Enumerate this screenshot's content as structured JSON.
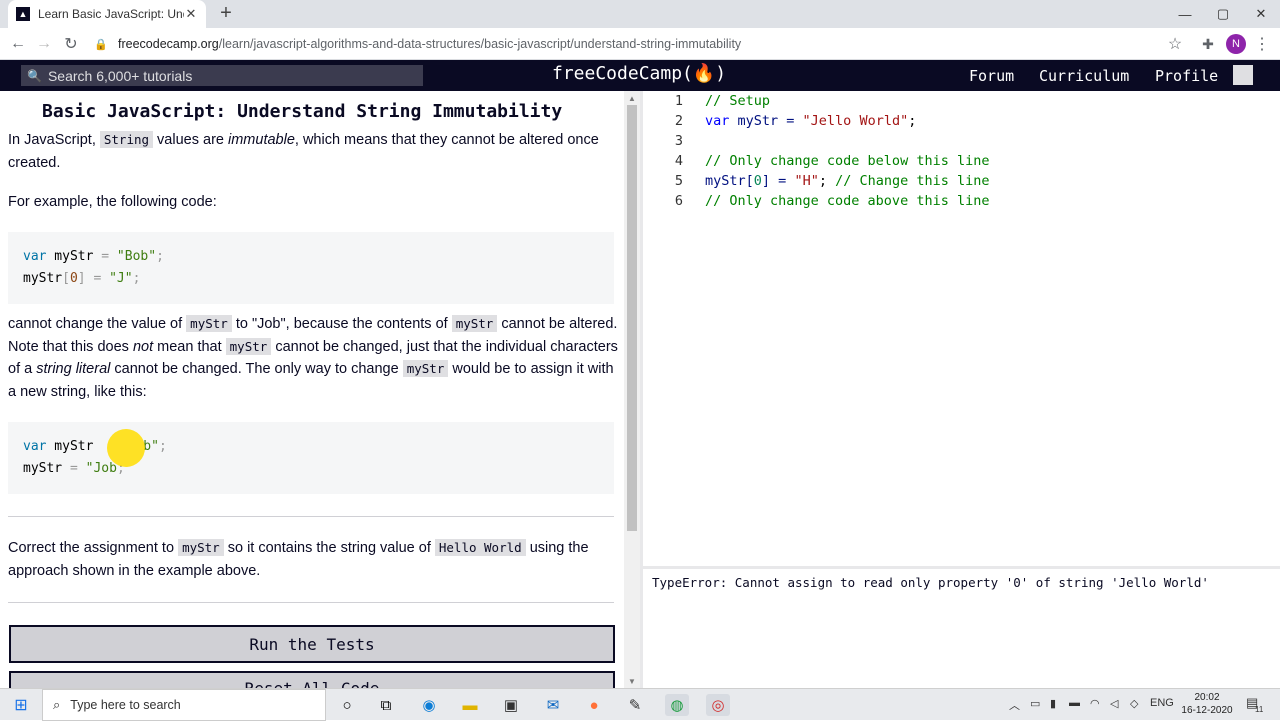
{
  "browser": {
    "tab_title": "Learn Basic JavaScript: Understan",
    "tab_favicon": "fcc-favicon",
    "url_host": "freecodecamp.org",
    "url_path": "/learn/javascript-algorithms-and-data-structures/basic-javascript/understand-string-immutability",
    "avatar_letter": "N"
  },
  "nav": {
    "search_placeholder": "Search 6,000+ tutorials",
    "logo": "freeCodeCamp(🔥)",
    "forum": "Forum",
    "curriculum": "Curriculum",
    "profile": "Profile"
  },
  "lesson": {
    "title": "Basic JavaScript: Understand String Immutability",
    "p1_a": "In JavaScript, ",
    "p1_code": "String",
    "p1_b": " values are ",
    "p1_em": "immutable",
    "p1_c": ", which means that they cannot be altered once created.",
    "p2": "For example, the following code:",
    "code1": {
      "l1_kw": "var",
      "l1_id": " myStr ",
      "l1_eq": "=",
      "l1_str": " \"Bob\"",
      "l1_end": ";",
      "l2_id": "myStr",
      "l2_b1": "[",
      "l2_num": "0",
      "l2_b2": "]",
      "l2_eq": " = ",
      "l2_str": "\"J\"",
      "l2_end": ";"
    },
    "p3_a": "cannot change the value of ",
    "p3_code1": "myStr",
    "p3_b": " to \"Job\", because the contents of ",
    "p3_code2": "myStr",
    "p3_c": " cannot be altered. Note that this does ",
    "p3_em1": "not",
    "p3_d": " mean that ",
    "p3_code3": "myStr",
    "p3_e": " cannot be changed, just that the individual characters of a ",
    "p3_em2": "string literal",
    "p3_f": " cannot be changed. The only way to change ",
    "p3_code4": "myStr",
    "p3_g": " would be to assign it with a new string, like this:",
    "code2": {
      "l1_kw": "var",
      "l1_id": " myStr ",
      "l1_str": "b\"",
      "l1_end": ";",
      "l2_id": "myStr",
      "l2_eq": " = ",
      "l2_str": "\"Job",
      "l2_end": ";"
    },
    "p4_a": "Correct the assignment to ",
    "p4_code1": "myStr",
    "p4_b": " so it contains the string value of ",
    "p4_code2": "Hello World",
    "p4_c": " using the approach shown in the example above.",
    "run_tests": "Run the Tests",
    "reset_partial": "Reset All Code"
  },
  "editor": {
    "lines": [
      {
        "n": "1",
        "text": "// Setup"
      },
      {
        "n": "2",
        "text": "var myStr = \"Jello World\";"
      },
      {
        "n": "3",
        "text": ""
      },
      {
        "n": "4",
        "text": "// Only change code below this line"
      },
      {
        "n": "5",
        "text": "myStr[0] = \"H\"; // Change this line"
      },
      {
        "n": "6",
        "text": "// Only change code above this line"
      }
    ],
    "l2": {
      "kw": "var",
      "id": " myStr = ",
      "str": "\"Jello World\"",
      "end": ";"
    },
    "l5": {
      "id": "myStr[",
      "num": "0",
      "mid": "] = ",
      "str": "\"H\"",
      "end": "; ",
      "cm": "// Change this line"
    }
  },
  "console": {
    "message": "TypeError: Cannot assign to read only property '0' of string 'Jello World'"
  },
  "taskbar": {
    "search_placeholder": "Type here to search",
    "lang": "ENG",
    "time": "20:02",
    "date": "16-12-2020",
    "notif_count": "11"
  }
}
